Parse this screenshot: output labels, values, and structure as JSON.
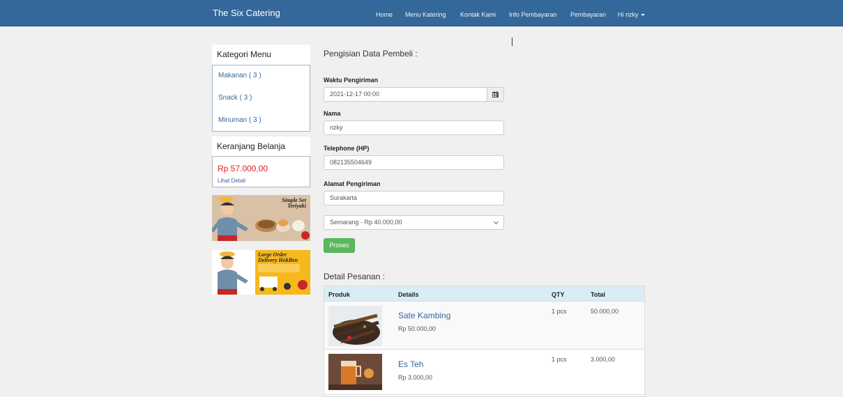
{
  "brand": "The Six Catering",
  "nav": {
    "home": "Home",
    "menu": "Menu Katering",
    "contact": "Kontak Kami",
    "payment_info": "Info Pembayaran",
    "payment": "Pembayaran",
    "user": "Hi rizky"
  },
  "sidebar": {
    "category_title": "Kategori Menu",
    "categories": [
      {
        "label": "Makanan ( 3 )"
      },
      {
        "label": "Snack ( 3 )"
      },
      {
        "label": "Minuman ( 3 )"
      }
    ],
    "cart_title": "Keranjang Belanja",
    "cart_total": "Rp 57.000,00",
    "cart_link": "Lihat Detail"
  },
  "banners": [
    {
      "text_line1": "Simple Set",
      "text_line2": "Teriyaki"
    },
    {
      "text_line1": "Large Order",
      "text_line2": "Delivery HokBen"
    }
  ],
  "form": {
    "title": "Pengisian Data Pembeli :",
    "delivery_time_label": "Waktu Pengiriman",
    "delivery_time_value": "2021-12-17 00:00",
    "name_label": "Nama",
    "name_value": "rizky",
    "phone_label": "Telephone (HP)",
    "phone_value": "082135504649",
    "address_label": "Alamat Pengiriman",
    "address_value": "Surakarta",
    "city_selected": "Semarang - Rp 40.000,00",
    "submit": "Proses"
  },
  "order": {
    "title": "Detail Pesanan :",
    "headers": {
      "product": "Produk",
      "details": "Details",
      "qty": "QTY",
      "total": "Total"
    },
    "items": [
      {
        "name": "Sate Kambing",
        "price": "Rp 50.000,00",
        "qty": "1 pcs",
        "total": "50.000,00"
      },
      {
        "name": "Es Teh",
        "price": "Rp 3.000,00",
        "qty": "1 pcs",
        "total": "3.000,00"
      }
    ]
  },
  "colors": {
    "navbar": "#35689a",
    "link": "#35689a",
    "price_red": "#e02020",
    "button_green": "#5cb85c",
    "table_header": "#d9edf7"
  }
}
